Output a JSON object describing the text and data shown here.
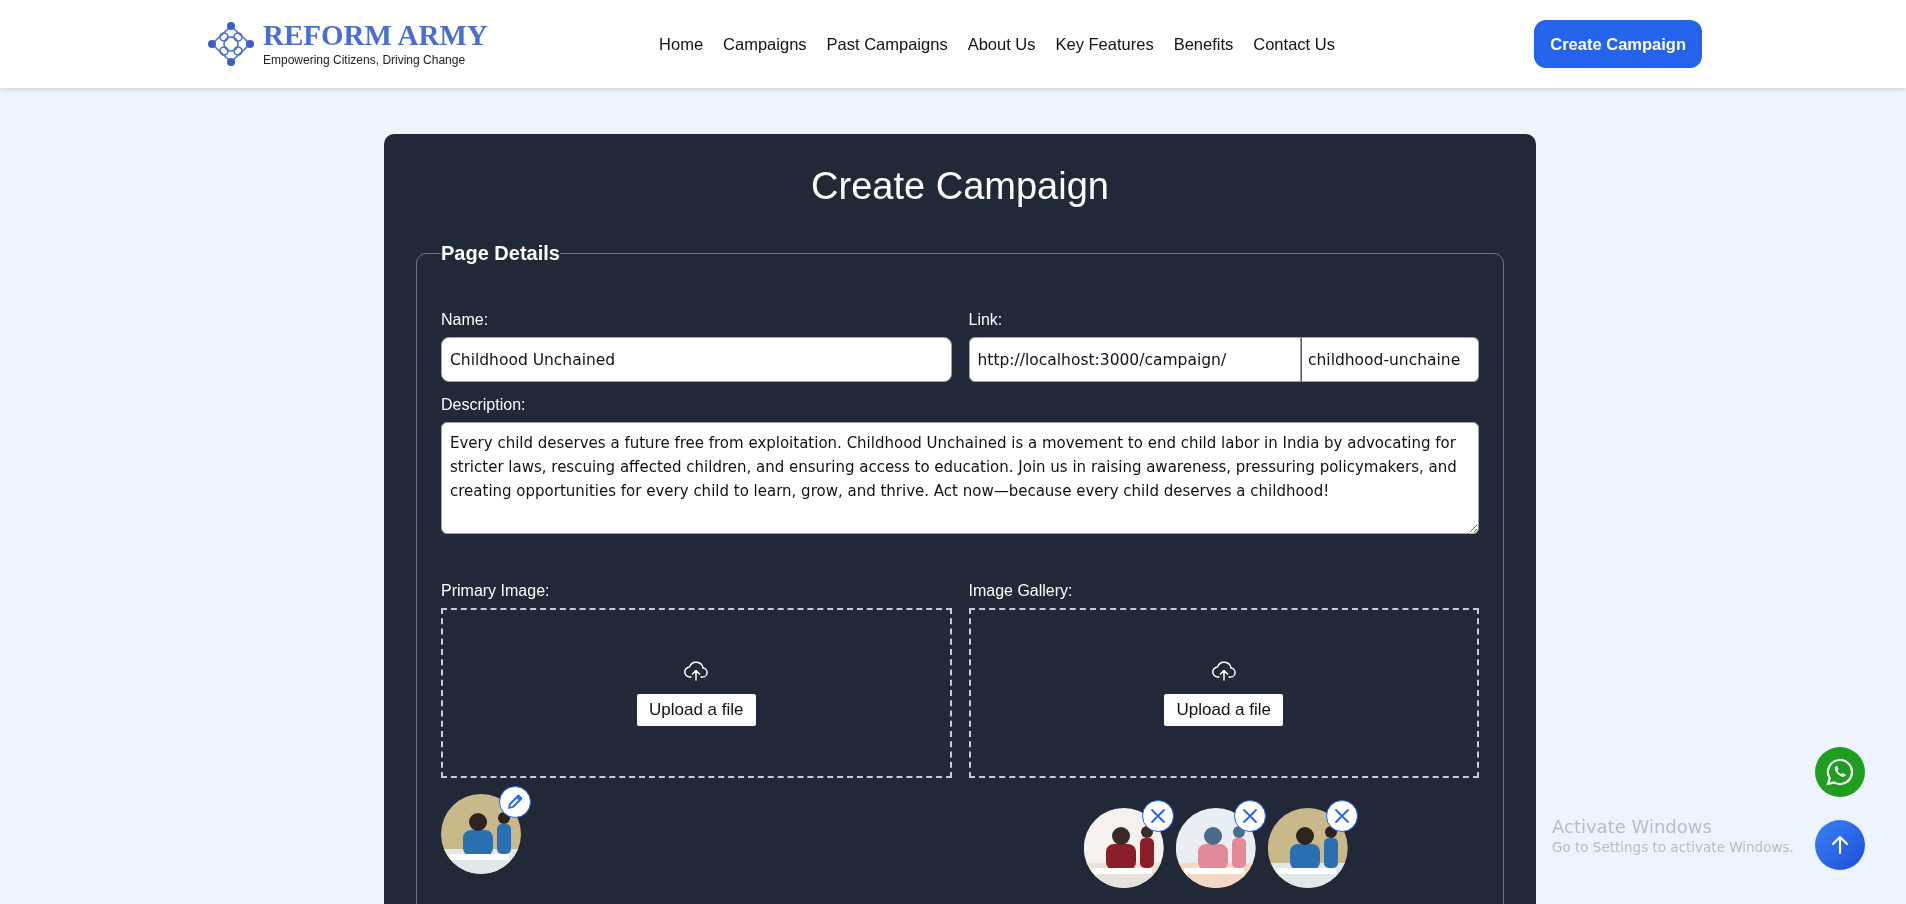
{
  "header": {
    "brand": "REFORM ARMY",
    "tagline": "Empowering Citizens, Driving Change",
    "nav": [
      {
        "label": "Home"
      },
      {
        "label": "Campaigns"
      },
      {
        "label": "Past Campaigns"
      },
      {
        "label": "About Us"
      },
      {
        "label": "Key Features"
      },
      {
        "label": "Benefits"
      },
      {
        "label": "Contact Us"
      }
    ],
    "cta": "Create Campaign"
  },
  "form": {
    "title": "Create Campaign",
    "section": "Page Details",
    "name": {
      "label": "Name:",
      "value": "Childhood Unchained"
    },
    "link": {
      "label": "Link:",
      "prefix": "http://localhost:3000/campaign/",
      "value": "childhood-unchaine"
    },
    "description": {
      "label": "Description:",
      "value": "Every child deserves a future free from exploitation. Childhood Unchained is a movement to end child labor in India by advocating for stricter laws, rescuing affected children, and ensuring access to education. Join us in raising awareness, pressuring policymakers, and creating opportunities for every child to learn, grow, and thrive. Act now—because every child deserves a childhood!"
    },
    "primary_image": {
      "label": "Primary Image:",
      "upload": "Upload a file",
      "images": [
        {
          "kind": "editable"
        }
      ]
    },
    "image_gallery": {
      "label": "Image Gallery:",
      "upload": "Upload a file",
      "images": [
        {
          "kind": "removable"
        },
        {
          "kind": "removable"
        },
        {
          "kind": "removable"
        }
      ]
    }
  },
  "os_notice": {
    "title": "Activate Windows",
    "text": "Go to Settings to activate Windows."
  }
}
